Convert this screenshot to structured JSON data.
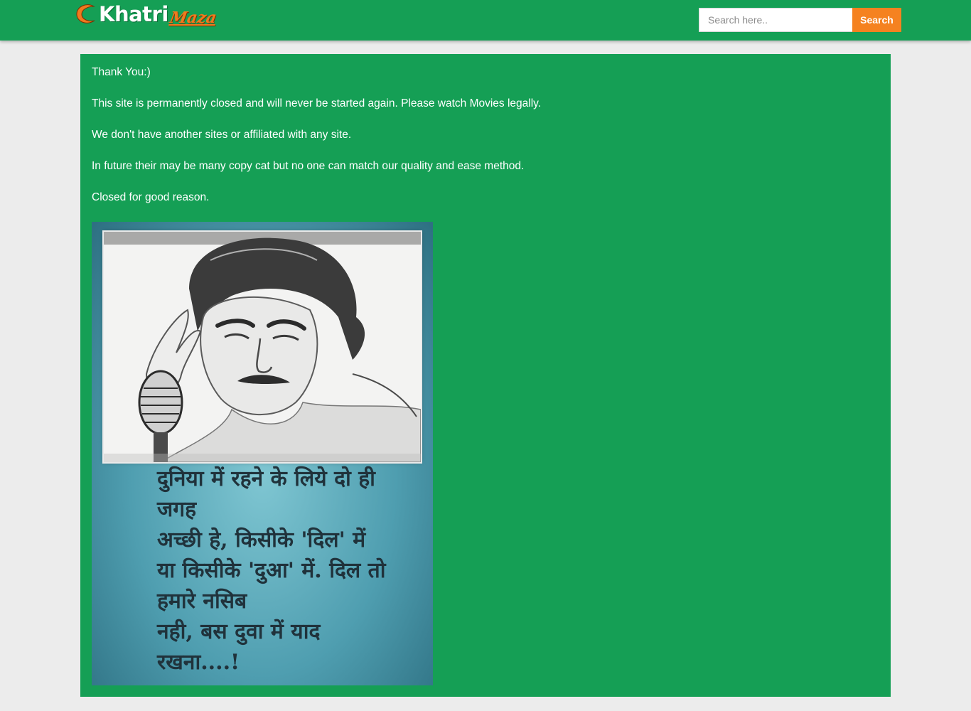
{
  "header": {
    "logo": {
      "main": "Khatri",
      "sub": "Maza"
    },
    "search": {
      "placeholder": "Search here..",
      "button_label": "Search"
    }
  },
  "notice": {
    "lines": [
      "Thank You:)",
      "This site is permanently closed and will never be started again. Please watch Movies legally.",
      "We don't have another sites or affiliated with any site.",
      "In future their may be many copy cat but no one can match our quality and ease method.",
      "Closed for good reason."
    ]
  },
  "poster": {
    "poem_lines": [
      "दुनिया में रहने के लिये दो ही",
      "जगह",
      "अच्छी हे, किसीके 'दिल' में",
      "या किसीके 'दुआ' में. दिल तो",
      "हमारे नसिब",
      "नही, बस दुवा में याद",
      "रखना....!"
    ]
  },
  "colors": {
    "brand_green": "#159f55",
    "accent_orange": "#f58220",
    "page_background": "#ececec"
  }
}
